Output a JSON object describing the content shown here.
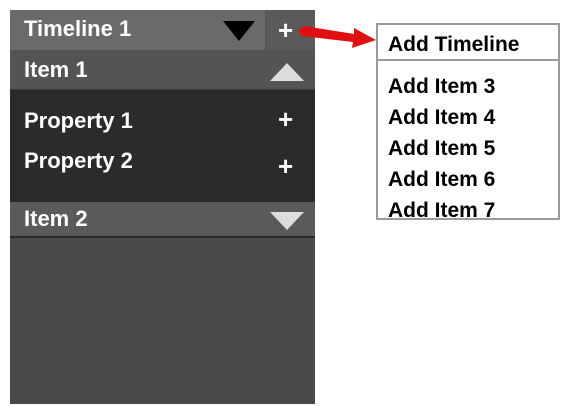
{
  "panel": {
    "timeline": {
      "label": "Timeline 1",
      "add_glyph": "+"
    },
    "items": [
      {
        "label": "Item 1",
        "expanded": true,
        "properties": [
          {
            "label": "Property 1",
            "add_glyph": "+"
          },
          {
            "label": "Property 2",
            "add_glyph": "+"
          }
        ]
      },
      {
        "label": "Item 2",
        "expanded": false
      }
    ]
  },
  "menu": {
    "header": "Add Timeline",
    "items": [
      "Add Item 3",
      "Add Item 4",
      "Add Item 5",
      "Add Item 6",
      "Add Item 7"
    ]
  },
  "colors": {
    "panel_bg": "#4a4a4a",
    "properties_bg": "#2b2b2b",
    "arrow": "#e01010",
    "menu_border": "#9a9a9a"
  },
  "icons": {
    "timeline_toggle": "triangle-down-black-icon",
    "item_collapse": "triangle-up-icon",
    "item_expand": "triangle-down-icon",
    "add": "plus-icon",
    "pointer": "red-arrow-icon"
  }
}
